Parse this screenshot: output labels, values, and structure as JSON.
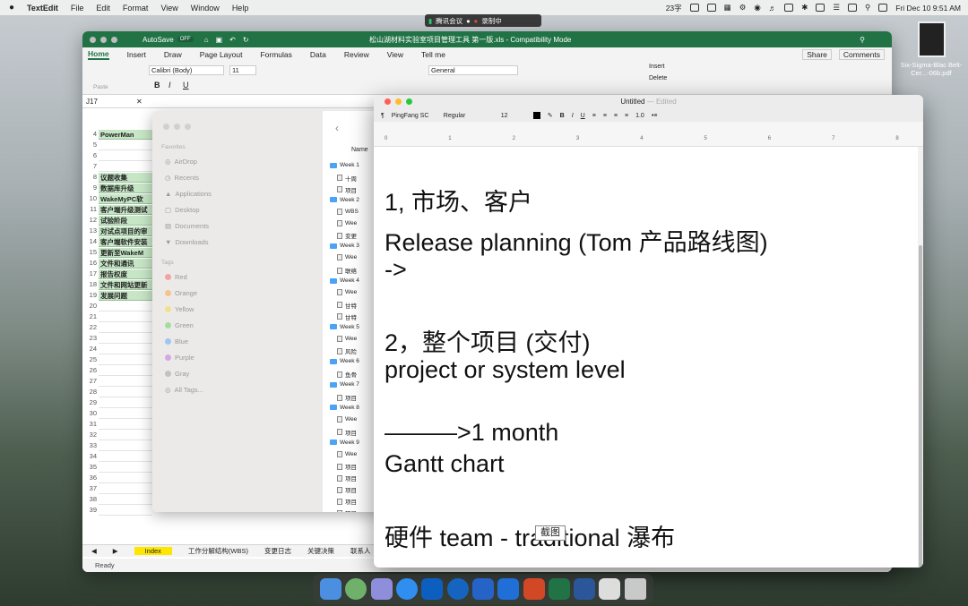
{
  "menubar": {
    "app": "TextEdit",
    "items": [
      "File",
      "Edit",
      "Format",
      "View",
      "Window",
      "Help"
    ],
    "wordcount": "23字",
    "datetime": "Fri Dec 10  9:51 AM"
  },
  "meeting": {
    "name": "腾讯会议",
    "record": "录制中"
  },
  "excel": {
    "autosave": "AutoSave",
    "autosave_state": "OFF",
    "title": "松山湖材料实验室项目管理工具 第一版.xls  -  Compatibility Mode",
    "tabs": [
      "Home",
      "Insert",
      "Draw",
      "Page Layout",
      "Formulas",
      "Data",
      "Review",
      "View",
      "Tell me"
    ],
    "share": "Share",
    "comments": "Comments",
    "font": "Calibri (Body)",
    "size": "11",
    "numformat": "General",
    "insert": "Insert",
    "delete": "Delete",
    "paste": "Paste",
    "cellref": "J17",
    "rows": [
      {
        "n": "4",
        "t": "PowerMan"
      },
      {
        "n": "5",
        "t": ""
      },
      {
        "n": "6",
        "t": ""
      },
      {
        "n": "7",
        "t": ""
      },
      {
        "n": "8",
        "t": "议题收集"
      },
      {
        "n": "9",
        "t": "数据库升级"
      },
      {
        "n": "10",
        "t": "WakeMyPC软"
      },
      {
        "n": "11",
        "t": "客户端升级测试"
      },
      {
        "n": "12",
        "t": "试验阶段"
      },
      {
        "n": "13",
        "t": "对试点项目的审"
      },
      {
        "n": "14",
        "t": "客户端软件安装"
      },
      {
        "n": "15",
        "t": "更新至WakeM"
      },
      {
        "n": "16",
        "t": "文件和通讯"
      },
      {
        "n": "17",
        "t": "报告权度"
      },
      {
        "n": "18",
        "t": "文件和网站更新"
      },
      {
        "n": "19",
        "t": "发展问题"
      },
      {
        "n": "20",
        "t": ""
      },
      {
        "n": "21",
        "t": ""
      },
      {
        "n": "22",
        "t": ""
      },
      {
        "n": "23",
        "t": ""
      },
      {
        "n": "24",
        "t": ""
      },
      {
        "n": "25",
        "t": ""
      },
      {
        "n": "26",
        "t": ""
      },
      {
        "n": "27",
        "t": ""
      },
      {
        "n": "28",
        "t": ""
      },
      {
        "n": "29",
        "t": ""
      },
      {
        "n": "30",
        "t": ""
      },
      {
        "n": "31",
        "t": ""
      },
      {
        "n": "32",
        "t": ""
      },
      {
        "n": "33",
        "t": ""
      },
      {
        "n": "34",
        "t": ""
      },
      {
        "n": "35",
        "t": ""
      },
      {
        "n": "36",
        "t": ""
      },
      {
        "n": "37",
        "t": ""
      },
      {
        "n": "38",
        "t": ""
      },
      {
        "n": "39",
        "t": ""
      }
    ],
    "sheets": [
      "Index",
      "工作分解结构(WBS)",
      "变更日志",
      "关键决策",
      "联系人"
    ],
    "status": "Ready"
  },
  "finder": {
    "favorites_label": "Favorites",
    "favorites": [
      "AirDrop",
      "Recents",
      "Applications",
      "Desktop",
      "Documents",
      "Downloads"
    ],
    "tags_label": "Tags",
    "tags": [
      {
        "name": "Red",
        "color": "#f4a3a3"
      },
      {
        "name": "Orange",
        "color": "#f5c48a"
      },
      {
        "name": "Yellow",
        "color": "#f3e08a"
      },
      {
        "name": "Green",
        "color": "#a6dca0"
      },
      {
        "name": "Blue",
        "color": "#9ec6f2"
      },
      {
        "name": "Purple",
        "color": "#d3a7e8"
      },
      {
        "name": "Gray",
        "color": "#c2c2c2"
      }
    ],
    "all_tags": "All Tags...",
    "name_col": "Name",
    "rows": [
      {
        "k": "f",
        "t": "Week 1"
      },
      {
        "k": "d",
        "t": "十周"
      },
      {
        "k": "d",
        "t": "项目"
      },
      {
        "k": "f",
        "t": "Week 2"
      },
      {
        "k": "d",
        "t": "WBS"
      },
      {
        "k": "d",
        "t": "Wee"
      },
      {
        "k": "d",
        "t": "变更"
      },
      {
        "k": "f",
        "t": "Week 3"
      },
      {
        "k": "d",
        "t": "Wee"
      },
      {
        "k": "d",
        "t": "联络"
      },
      {
        "k": "f",
        "t": "Week 4"
      },
      {
        "k": "d",
        "t": "Wee"
      },
      {
        "k": "d",
        "t": "甘特"
      },
      {
        "k": "d",
        "t": "甘特"
      },
      {
        "k": "f",
        "t": "Week 5"
      },
      {
        "k": "d",
        "t": "Wee"
      },
      {
        "k": "d",
        "t": "风险"
      },
      {
        "k": "f",
        "t": "Week 6"
      },
      {
        "k": "d",
        "t": "鱼骨"
      },
      {
        "k": "f",
        "t": "Week 7"
      },
      {
        "k": "d",
        "t": "项目"
      },
      {
        "k": "f",
        "t": "Week 8"
      },
      {
        "k": "d",
        "t": "Wee"
      },
      {
        "k": "d",
        "t": "项目"
      },
      {
        "k": "f",
        "t": "Week 9"
      },
      {
        "k": "d",
        "t": "Wee"
      },
      {
        "k": "d",
        "t": "项目"
      },
      {
        "k": "d",
        "t": "项目"
      },
      {
        "k": "d",
        "t": "项目"
      },
      {
        "k": "d",
        "t": "项目"
      },
      {
        "k": "d",
        "t": "项目"
      }
    ]
  },
  "textedit": {
    "title": "Untitled",
    "edited": "Edited",
    "font": "PingFang SC",
    "style": "Regular",
    "size": "12",
    "spacing": "1.0",
    "ruler": [
      "0",
      "1",
      "2",
      "3",
      "4",
      "5",
      "6",
      "7",
      "8"
    ],
    "lines": [
      "1, 市场、客户",
      "Release planning (Tom  产品路线图)",
      "->",
      "2，整个项目 (交付)",
      "project or system level",
      "———>1 month",
      "Gantt chart",
      "硬件 team - traditional 瀑布"
    ]
  },
  "tooltip": "截图",
  "desktop_file": "Six-Sigma-Blac Belt-Cer...-06b.pdf"
}
